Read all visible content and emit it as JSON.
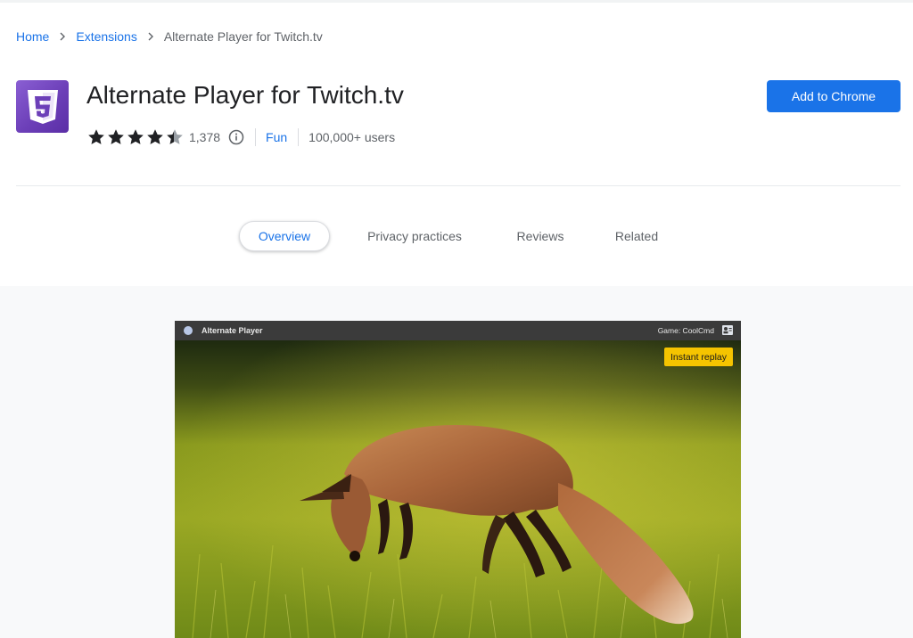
{
  "breadcrumb": {
    "home": "Home",
    "extensions": "Extensions",
    "current": "Alternate Player for Twitch.tv"
  },
  "extension": {
    "title": "Alternate Player for Twitch.tv",
    "rating": 4.4,
    "rating_count": "1,378",
    "category": "Fun",
    "users": "100,000+ users",
    "icon": "html5-shield-icon",
    "icon_color": "#6c3fb8"
  },
  "actions": {
    "add_label": "Add to Chrome",
    "add_color": "#1a73e8"
  },
  "tabs": [
    {
      "label": "Overview",
      "active": true
    },
    {
      "label": "Privacy practices",
      "active": false
    },
    {
      "label": "Reviews",
      "active": false
    },
    {
      "label": "Related",
      "active": false
    }
  ],
  "screenshot": {
    "player_title": "Alternate Player",
    "game_label": "Game: CoolCmd",
    "replay_label": "Instant replay"
  }
}
